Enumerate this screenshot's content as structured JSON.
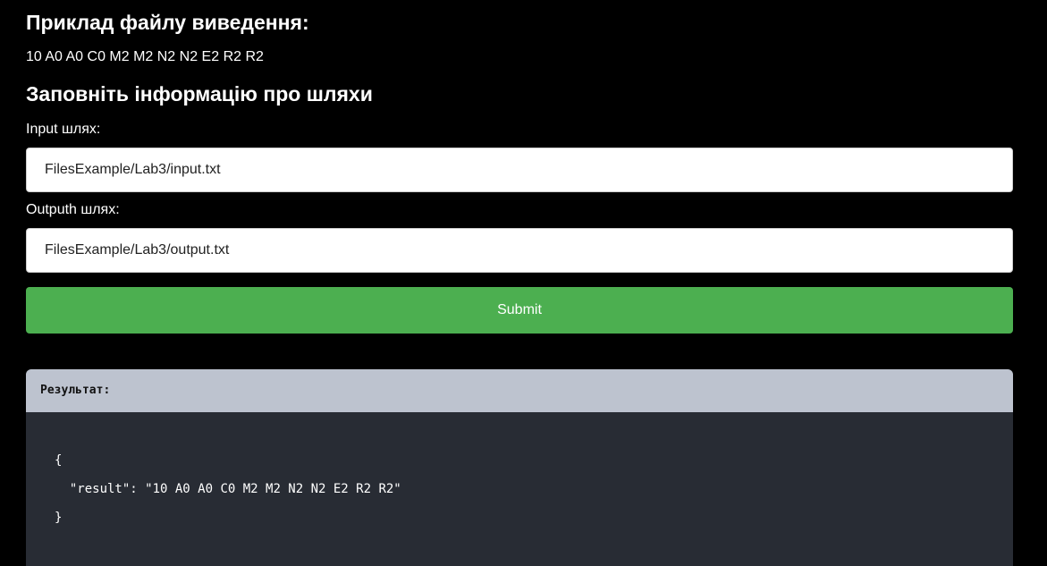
{
  "output_example": {
    "heading": "Приклад файлу виведення:",
    "value": "10 A0 A0 C0 M2 M2 N2 N2 E2 R2 R2"
  },
  "paths_form": {
    "heading": "Заповніть інформацію про шляхи",
    "input_label": "Input шлях:",
    "input_value": "FilesExample/Lab3/input.txt",
    "output_label": "Outputh шлях:",
    "output_value": "FilesExample/Lab3/output.txt",
    "submit_label": "Submit"
  },
  "result": {
    "header": "Результат:",
    "open_brace": "{",
    "key": "\"result\"",
    "separator": ": ",
    "value": "\"10 A0 A0 C0 M2 M2 N2 N2 E2 R2 R2\"",
    "close_brace": "}"
  },
  "colors": {
    "background": "#000000",
    "submit": "#4caf50",
    "result_header": "#bdc3cf",
    "result_body": "#282c34"
  }
}
